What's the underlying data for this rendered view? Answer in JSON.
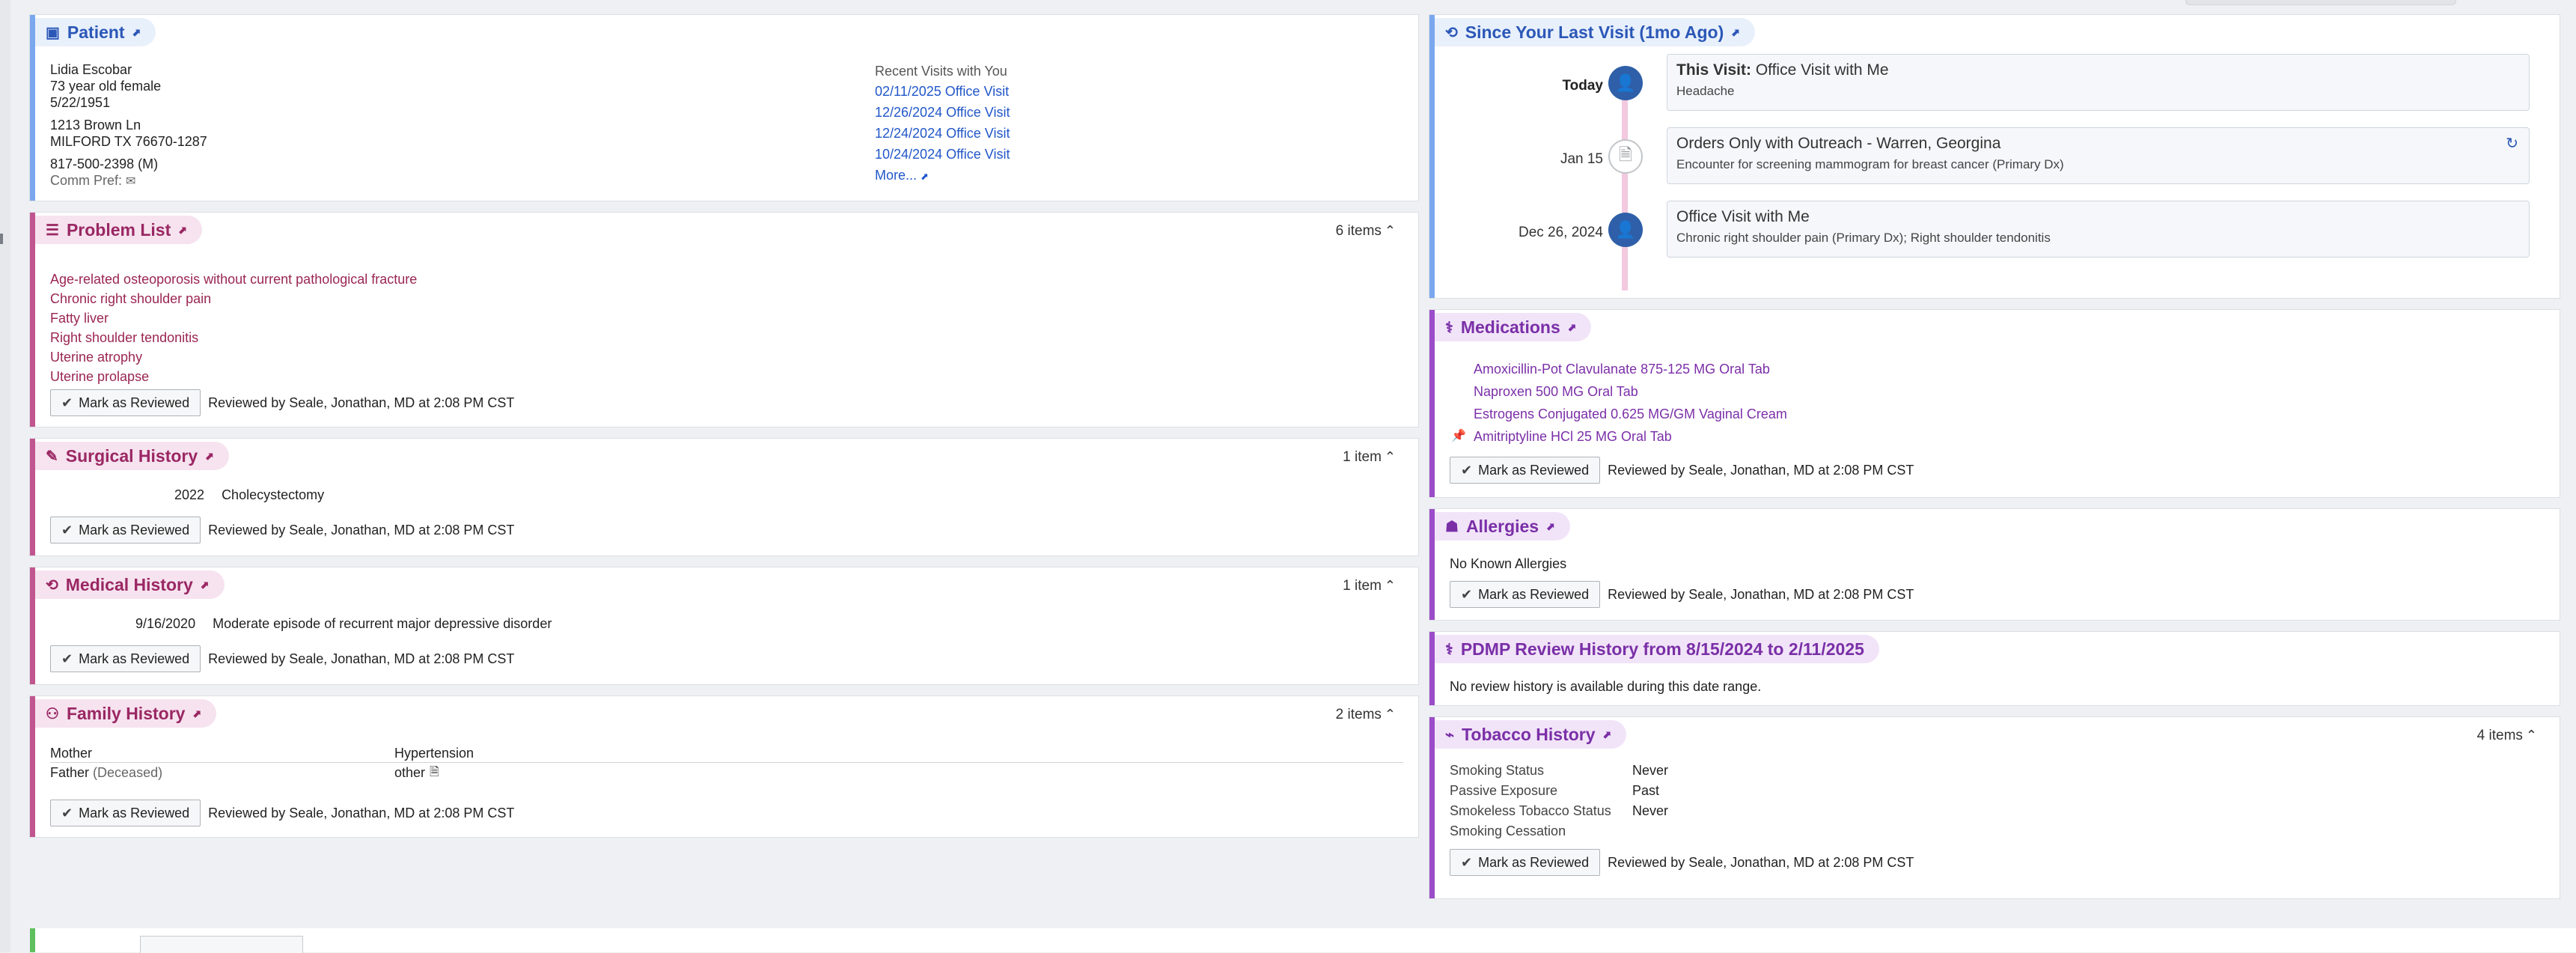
{
  "patient": {
    "title": "Patient",
    "name": "Lidia Escobar",
    "age_sex": "73 year old female",
    "dob": "5/22/1951",
    "address1": "1213 Brown Ln",
    "address2": "MILFORD TX 76670-1287",
    "phone": "817-500-2398 (M)",
    "comm_pref": "Comm Pref:",
    "recent_visits_label": "Recent Visits with You",
    "recent_visits": [
      "02/11/2025 Office Visit",
      "12/26/2024 Office Visit",
      "12/24/2024 Office Visit",
      "10/24/2024 Office Visit"
    ],
    "more": "More..."
  },
  "problem_list": {
    "title": "Problem List",
    "count": "6 items",
    "items": [
      "Age-related osteoporosis without current pathological fracture",
      "Chronic right shoulder pain",
      "Fatty liver",
      "Right shoulder tendonitis",
      "Uterine atrophy",
      "Uterine prolapse"
    ],
    "button": "Mark as Reviewed",
    "reviewed": "Reviewed by Seale, Jonathan, MD at 2:08 PM CST"
  },
  "surgical_history": {
    "title": "Surgical History",
    "count": "1 item",
    "year": "2022",
    "procedure": "Cholecystectomy",
    "button": "Mark as Reviewed",
    "reviewed": "Reviewed by Seale, Jonathan, MD at 2:08 PM CST"
  },
  "medical_history": {
    "title": "Medical History",
    "count": "1 item",
    "date": "9/16/2020",
    "diagnosis": "Moderate episode of recurrent major depressive disorder",
    "button": "Mark as Reviewed",
    "reviewed": "Reviewed by Seale, Jonathan, MD at 2:08 PM CST"
  },
  "family_history": {
    "title": "Family History",
    "count": "2 items",
    "rows": [
      {
        "relation": "Mother",
        "condition": "Hypertension"
      },
      {
        "relation": "Father",
        "status": "(Deceased)",
        "condition": "other"
      }
    ],
    "button": "Mark as Reviewed",
    "reviewed": "Reviewed by Seale, Jonathan, MD at 2:08 PM CST"
  },
  "since_last_visit": {
    "title": "Since Your Last Visit (1mo Ago)",
    "events": [
      {
        "date": "Today",
        "title_bold": "This Visit:",
        "title": "Office Visit with Me",
        "sub": "Headache"
      },
      {
        "date": "Jan 15",
        "title": "Orders Only with Outreach - Warren, Georgina",
        "sub": "Encounter for screening mammogram for breast cancer (Primary Dx)"
      },
      {
        "date": "Dec 26, 2024",
        "title": "Office Visit with Me",
        "sub": "Chronic right shoulder pain (Primary Dx); Right shoulder tendonitis"
      }
    ]
  },
  "medications": {
    "title": "Medications",
    "items": [
      "Amoxicillin-Pot Clavulanate 875-125 MG Oral Tab",
      "Naproxen 500 MG Oral Tab",
      "Estrogens Conjugated 0.625 MG/GM Vaginal Cream",
      "Amitriptyline HCl 25 MG Oral Tab"
    ],
    "button": "Mark as Reviewed",
    "reviewed": "Reviewed by Seale, Jonathan, MD at 2:08 PM CST"
  },
  "allergies": {
    "title": "Allergies",
    "text": "No Known Allergies",
    "button": "Mark as Reviewed",
    "reviewed": "Reviewed by Seale, Jonathan, MD at 2:08 PM CST"
  },
  "pdmp": {
    "title": "PDMP Review History from 8/15/2024 to 2/11/2025",
    "text": "No review history is available during this date range."
  },
  "tobacco": {
    "title": "Tobacco History",
    "count": "4 items",
    "rows": [
      {
        "label": "Smoking Status",
        "value": "Never"
      },
      {
        "label": "Passive Exposure",
        "value": "Past"
      },
      {
        "label": "Smokeless Tobacco Status",
        "value": "Never"
      },
      {
        "label": "Smoking Cessation",
        "value": ""
      }
    ],
    "button": "Mark as Reviewed",
    "reviewed": "Reviewed by Seale, Jonathan, MD at 2:08 PM CST"
  },
  "colors": {
    "blue_accent": "#7aa7ee",
    "pink_accent": "#c0558f",
    "purple_accent": "#9b4cc9",
    "link_blue": "#2157c9"
  }
}
